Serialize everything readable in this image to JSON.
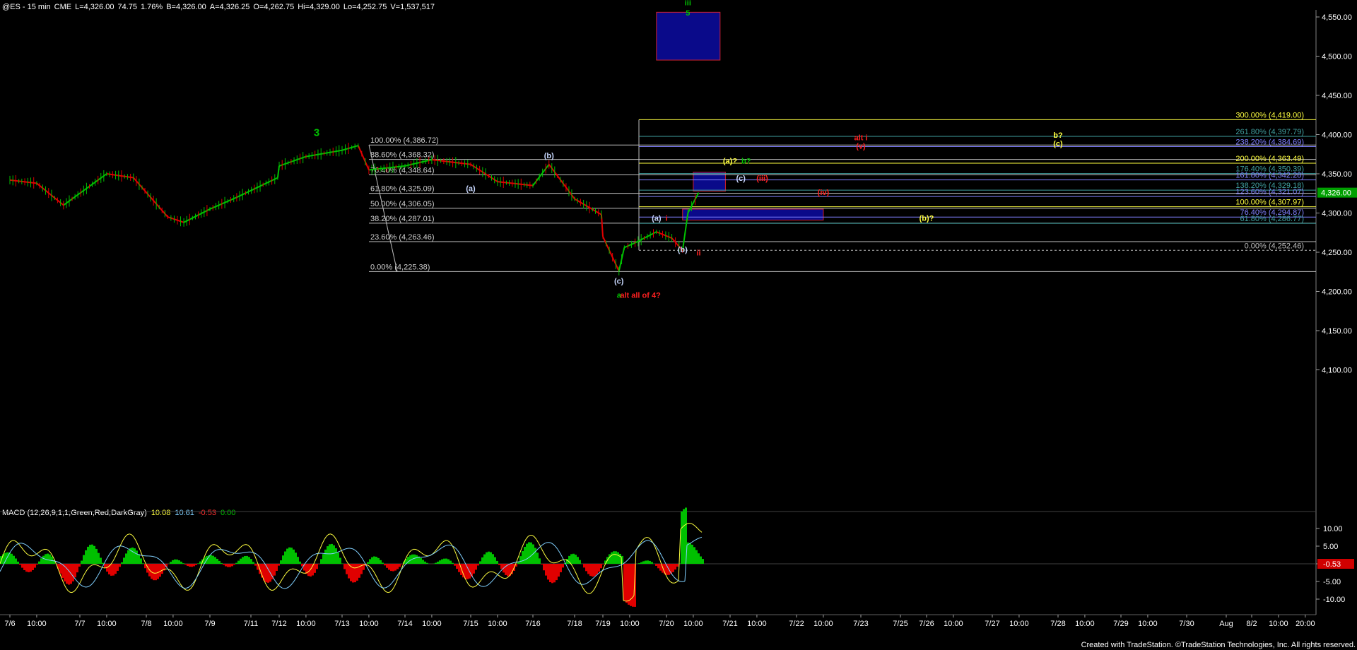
{
  "header": {
    "symbol": "@ES - 15 min",
    "exchange": "CME",
    "last": "L=4,326.00",
    "change": "74.75",
    "change_pct": "1.76%",
    "bid": "B=4,326.00",
    "ask": "A=4,326.25",
    "open": "O=4,262.75",
    "high": "Hi=4,329.00",
    "low": "Lo=4,252.75",
    "volume": "V=1,537,517"
  },
  "macd": {
    "label": "MACD (12,26,9,1,1,Green,Red,DarkGray)",
    "v1": "10.08",
    "v2": "10.61",
    "v3": "-0.53",
    "v4": "0.00",
    "current_label": "-0.53",
    "y_ticks": [
      "10.00",
      "5.00",
      "0.00",
      "-5.00",
      "-10.00"
    ]
  },
  "footer": "Created with TradeStation. ©TradeStation Technologies, Inc. All rights reserved.",
  "colors": {
    "background": "#000000",
    "up": "#00c000",
    "down": "#e00000",
    "fib_line": "#c0c0c0",
    "box_fill": "#0a0a8a",
    "box_border": "#d02030",
    "yellow": "#ffff40",
    "green_label": "#00c000",
    "red_label": "#ff2020",
    "white_label": "#c8d8ff",
    "price_marker": "#00a000"
  },
  "chart_data": {
    "type": "line",
    "title": "@ES - 15 min",
    "xlabel": "",
    "ylabel": "",
    "ylim": [
      4050,
      4575
    ],
    "price_ticks": [
      "4,550.00",
      "4,500.00",
      "4,450.00",
      "4,400.00",
      "4,350.00",
      "4,300.00",
      "4,250.00",
      "4,200.00",
      "4,150.00",
      "4,100.00"
    ],
    "price_tick_values": [
      4550,
      4500,
      4450,
      4400,
      4350,
      4300,
      4250,
      4200,
      4150,
      4100
    ],
    "current_price": 4326.0,
    "current_price_label": "4,326.00",
    "x_ticks": [
      "7/6",
      "10:00",
      "7/7",
      "10:00",
      "7/8",
      "10:00",
      "7/9",
      "7/11",
      "7/12",
      "10:00",
      "7/13",
      "10:00",
      "7/14",
      "10:00",
      "7/15",
      "10:00",
      "7/16",
      "7/18",
      "7/19",
      "10:00",
      "7/20",
      "10:00",
      "7/21",
      "10:00",
      "7/22",
      "10:00",
      "7/23",
      "7/25",
      "7/26",
      "10:00",
      "7/27",
      "10:00",
      "7/28",
      "10:00",
      "7/29",
      "10:00",
      "7/30",
      "Aug",
      "8/2",
      "10:00",
      "20:00"
    ],
    "series": [
      {
        "x": [
          "7/6 00:00",
          "7/6 10:00",
          "7/6 20:00",
          "7/7 10:00",
          "7/7 20:00",
          "7/8 08:00",
          "7/8 14:00",
          "7/9 00:00",
          "7/9 10:00",
          "7/11 10:00",
          "7/12 00:00",
          "7/12 10:00",
          "7/13 00:00",
          "7/13 06:00",
          "7/13 10:00",
          "7/14 00:00",
          "7/14 10:00",
          "7/15 00:00",
          "7/15 10:00",
          "7/16 00:00",
          "7/16 06:00",
          "7/18 00:00",
          "7/18 10:00",
          "7/19 00:00",
          "7/19 06:00",
          "7/19 08:00",
          "7/19 12:00",
          "7/19 20:00",
          "7/20 02:00",
          "7/20 06:00",
          "7/20 08:00",
          "7/20 12:00"
        ],
        "values": [
          4342,
          4338,
          4310,
          4350,
          4345,
          4295,
          4288,
          4305,
          4320,
          4345,
          4360,
          4372,
          4380,
          4386,
          4355,
          4360,
          4368,
          4362,
          4340,
          4335,
          4362,
          4318,
          4298,
          4270,
          4226,
          4256,
          4262,
          4276,
          4268,
          4252,
          4300,
          4326
        ]
      }
    ],
    "fib_left": [
      {
        "label": "100.00% (4,386.72)",
        "value": 4386.72
      },
      {
        "label": "88.60% (4,368.32)",
        "value": 4368.32
      },
      {
        "label": "76.40% (4,348.64)",
        "value": 4348.64
      },
      {
        "label": "61.80% (4,325.09)",
        "value": 4325.09
      },
      {
        "label": "50.00% (4,306.05)",
        "value": 4306.05
      },
      {
        "label": "38.20% (4,287.01)",
        "value": 4287.01
      },
      {
        "label": "23.60% (4,263.46)",
        "value": 4263.46
      },
      {
        "label": "0.00% (4,225.38)",
        "value": 4225.38
      }
    ],
    "fib_right": [
      {
        "label": "300.00% (4,419.00)",
        "value": 4419.0,
        "color": "#ffff40"
      },
      {
        "label": "261.80% (4,397.79)",
        "value": 4397.79,
        "color": "#40a0a0"
      },
      {
        "label": "238.20% (4,384.69)",
        "value": 4384.69,
        "color": "#8080ff"
      },
      {
        "label": "200.00% (4,363.49)",
        "value": 4363.49,
        "color": "#ffff40"
      },
      {
        "label": "176.40% (4,350.39)",
        "value": 4350.39,
        "color": "#40a0a0"
      },
      {
        "label": "161.80% (4,342.28)",
        "value": 4342.28,
        "color": "#8080ff"
      },
      {
        "label": "138.20% (4,329.18)",
        "value": 4329.18,
        "color": "#40a0a0"
      },
      {
        "label": "123.60% (4,321.07)",
        "value": 4321.07,
        "color": "#8080ff"
      },
      {
        "label": "100.00% (4,307.97)",
        "value": 4307.97,
        "color": "#ffff40"
      },
      {
        "label": "76.40% (4,294.87)",
        "value": 4294.87,
        "color": "#8080ff"
      },
      {
        "label": "61.80% (4,286.77)",
        "value": 4286.77,
        "color": "#40a0a0"
      },
      {
        "label": "0.00% (4,252.46)",
        "value": 4252.46,
        "color": "#c0c0c0"
      }
    ],
    "boxes": [
      {
        "name": "target-box-top",
        "x": [
          "7/19 20:00",
          "7/20 20:00"
        ],
        "y": [
          4495,
          4556
        ]
      },
      {
        "name": "target-box-mid",
        "x": [
          "7/20 10:00",
          "7/20 22:00"
        ],
        "y": [
          4328,
          4352
        ]
      },
      {
        "name": "target-box-low",
        "x": [
          "7/20 06:00",
          "7/22 10:00"
        ],
        "y": [
          4291,
          4305
        ]
      }
    ],
    "annotations": [
      {
        "text": "iii",
        "color": "#00c000",
        "at": [
          "7/20 08:00",
          4565
        ]
      },
      {
        "text": "5",
        "color": "#00c000",
        "at": [
          "7/20 08:00",
          4552
        ]
      },
      {
        "text": "3",
        "color": "#00c000",
        "at": [
          "7/12 14:00",
          4398
        ]
      },
      {
        "text": "(b)",
        "color": "#c8d8ff",
        "at": [
          "7/16 06:00",
          4370
        ]
      },
      {
        "text": "(a)",
        "color": "#c8d8ff",
        "at": [
          "7/15 00:00",
          4328
        ]
      },
      {
        "text": "(c)",
        "color": "#c8d8ff",
        "at": [
          "7/19 06:00",
          4210
        ]
      },
      {
        "text": "a",
        "color": "#00c000",
        "at": [
          "7/19 06:00",
          4192
        ]
      },
      {
        "text": "alt all of 4?",
        "color": "#ff2020",
        "at": [
          "7/19 14:00",
          4192
        ]
      },
      {
        "text": "(a)",
        "color": "#c8d8ff",
        "at": [
          "7/19 20:00",
          4290
        ]
      },
      {
        "text": "i",
        "color": "#ff2020",
        "at": [
          "7/20 00:00",
          4290
        ]
      },
      {
        "text": "(b)",
        "color": "#c8d8ff",
        "at": [
          "7/20 06:00",
          4250
        ]
      },
      {
        "text": "ii",
        "color": "#ff2020",
        "at": [
          "7/20 12:00",
          4246
        ]
      },
      {
        "text": "(a)?",
        "color": "#ffff40",
        "at": [
          "7/21 00:00",
          4363
        ]
      },
      {
        "text": "b?",
        "color": "#00c000",
        "at": [
          "7/21 06:00",
          4363
        ]
      },
      {
        "text": "(c)",
        "color": "#c8d8ff",
        "at": [
          "7/21 04:00",
          4341
        ]
      },
      {
        "text": "(iii)",
        "color": "#ff2020",
        "at": [
          "7/21 12:00",
          4341
        ]
      },
      {
        "text": "(iv)",
        "color": "#ff2020",
        "at": [
          "7/22 10:00",
          4323
        ]
      },
      {
        "text": "alt i",
        "color": "#ff2020",
        "at": [
          "7/23 00:00",
          4393
        ]
      },
      {
        "text": "(v)",
        "color": "#ff2020",
        "at": [
          "7/23 00:00",
          4382
        ]
      },
      {
        "text": "b?",
        "color": "#ffff40",
        "at": [
          "7/28 00:00",
          4396
        ]
      },
      {
        "text": "(c)",
        "color": "#ffff40",
        "at": [
          "7/28 00:00",
          4385
        ]
      },
      {
        "text": "(b)?",
        "color": "#ffff40",
        "at": [
          "7/26 00:00",
          4290
        ]
      }
    ]
  }
}
